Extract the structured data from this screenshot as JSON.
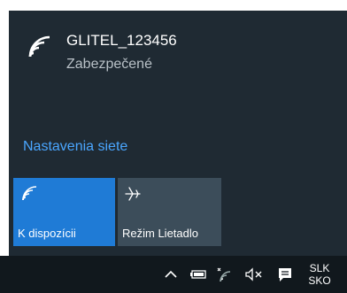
{
  "network": {
    "ssid": "GLITEL_123456",
    "status": "Zabezpečené"
  },
  "settings_link": "Nastavenia siete",
  "tiles": [
    {
      "label": "K dispozícii",
      "icon": "wifi-icon",
      "color": "#1f7bd6"
    },
    {
      "label": "Režim Lietadlo",
      "icon": "airplane-icon",
      "color": "#3c4d5a"
    }
  ],
  "taskbar": {
    "icons": [
      "chevron-up-icon",
      "battery-icon",
      "wifi-icon",
      "volume-muted-icon",
      "notification-icon"
    ],
    "language_line1": "SLK",
    "language_line2": "SKO"
  }
}
